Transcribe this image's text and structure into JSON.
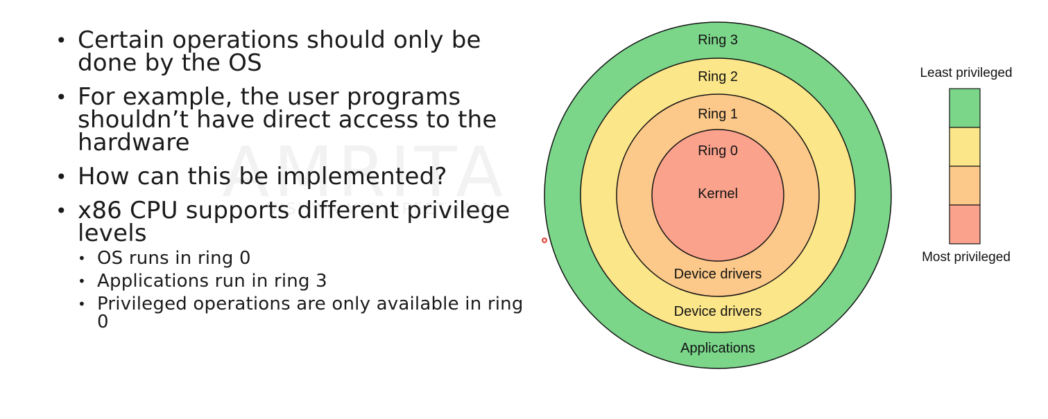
{
  "watermark": {
    "logo_text": "AMRITA",
    "tagline": "VISHWA VIDYAPEETHAM",
    "suffix": "Online"
  },
  "bullets": [
    {
      "text": "Certain operations should only be done by the OS"
    },
    {
      "text": "For example, the user programs shouldn’t have direct access to the hardware"
    },
    {
      "text": "How can this be implemented?"
    },
    {
      "text": "x86 CPU supports different privilege levels",
      "sub": [
        "OS runs in ring 0",
        "Applications run in ring 3",
        "Privileged operations are only available in ring 0"
      ]
    }
  ],
  "rings": [
    {
      "name": "Ring 3",
      "bottom_label": "Applications",
      "color": "#7bd68a"
    },
    {
      "name": "Ring 2",
      "bottom_label": "Device drivers",
      "color": "#fce68a"
    },
    {
      "name": "Ring 1",
      "bottom_label": "Device drivers",
      "color": "#fcc98a"
    },
    {
      "name": "Ring 0",
      "center_label": "Kernel",
      "color": "#fba28d"
    }
  ],
  "scale": {
    "top_label": "Least privileged",
    "bottom_label": "Most privileged",
    "colors": [
      "#7bd68a",
      "#fce68a",
      "#fcc98a",
      "#fba28d"
    ]
  }
}
